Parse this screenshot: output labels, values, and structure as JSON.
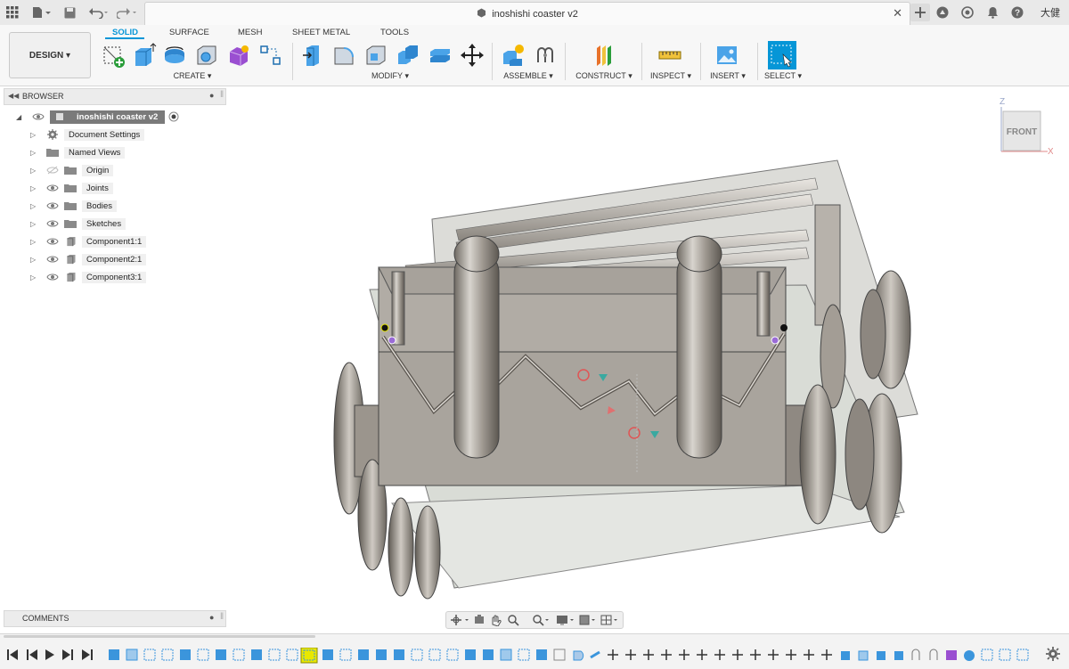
{
  "document": {
    "title": "inoshishi coaster v2",
    "user": "大健"
  },
  "workspace": {
    "mode": "DESIGN"
  },
  "tabs": [
    "SOLID",
    "SURFACE",
    "MESH",
    "SHEET METAL",
    "TOOLS"
  ],
  "groups": {
    "create": "CREATE",
    "modify": "MODIFY",
    "assemble": "ASSEMBLE",
    "construct": "CONSTRUCT",
    "inspect": "INSPECT",
    "insert": "INSERT",
    "select": "SELECT"
  },
  "browser": {
    "title": "BROWSER",
    "root": "inoshishi coaster v2",
    "items": [
      {
        "label": "Document Settings",
        "icon": "gear-icon"
      },
      {
        "label": "Named Views",
        "icon": "folder-icon"
      },
      {
        "label": "Origin",
        "icon": "folder-icon"
      },
      {
        "label": "Joints",
        "icon": "folder-icon"
      },
      {
        "label": "Bodies",
        "icon": "folder-icon"
      },
      {
        "label": "Sketches",
        "icon": "folder-icon"
      },
      {
        "label": "Component1:1",
        "icon": "component-icon"
      },
      {
        "label": "Component2:1",
        "icon": "component-icon"
      },
      {
        "label": "Component3:1",
        "icon": "component-icon"
      }
    ]
  },
  "comments": {
    "title": "COMMENTS"
  },
  "viewcube": {
    "face": "FRONT",
    "axis_z": "Z",
    "axis_x": "X"
  },
  "colors": {
    "accent": "#0696d7",
    "background": "#ffffff",
    "model": "#a9a39b",
    "highlight": "#e8e800"
  }
}
